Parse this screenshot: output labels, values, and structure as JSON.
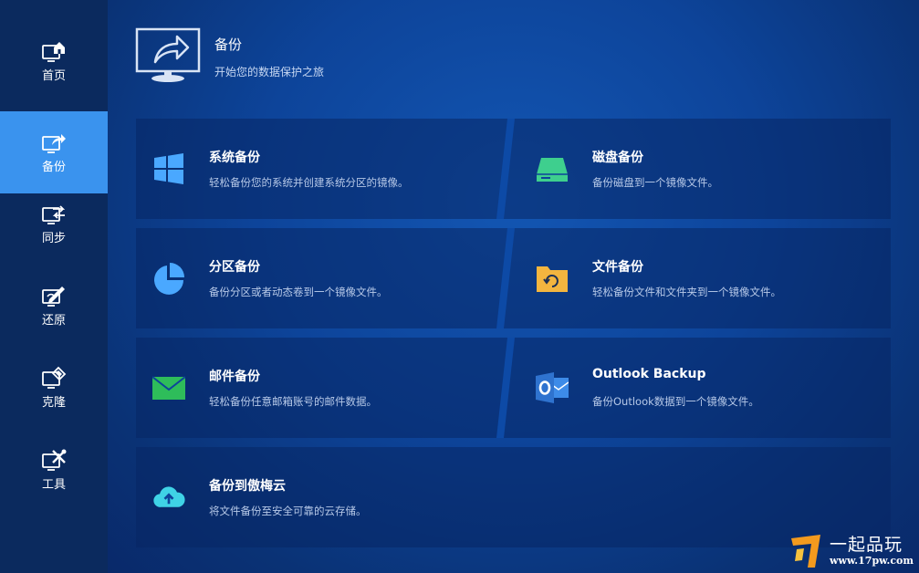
{
  "sidebar": {
    "items": [
      {
        "label": "首页",
        "icon": "home-monitor-icon",
        "active": false
      },
      {
        "label": "备份",
        "icon": "backup-monitor-icon",
        "active": true
      },
      {
        "label": "同步",
        "icon": "sync-icon",
        "active": false
      },
      {
        "label": "还原",
        "icon": "restore-monitor-icon",
        "active": false
      },
      {
        "label": "克隆",
        "icon": "clone-monitor-icon",
        "active": false
      },
      {
        "label": "工具",
        "icon": "tools-monitor-icon",
        "active": false
      }
    ]
  },
  "header": {
    "title": "备份",
    "subtitle": "开始您的数据保护之旅",
    "icon": "monitor-share-arrow-icon"
  },
  "tiles": [
    {
      "title": "系统备份",
      "desc": "轻松备份您的系统并创建系统分区的镜像。",
      "icon": "windows-logo-icon",
      "color": "#4aa8ff"
    },
    {
      "title": "磁盘备份",
      "desc": "备份磁盘到一个镜像文件。",
      "icon": "disk-drive-icon",
      "color": "#3ecf8e"
    },
    {
      "title": "分区备份",
      "desc": "备份分区或者动态卷到一个镜像文件。",
      "icon": "pie-chart-icon",
      "color": "#4aa8ff"
    },
    {
      "title": "文件备份",
      "desc": "轻松备份文件和文件夹到一个镜像文件。",
      "icon": "folder-refresh-icon",
      "color": "#f3b53f"
    },
    {
      "title": "邮件备份",
      "desc": "轻松备份任意邮箱账号的邮件数据。",
      "icon": "mail-envelope-icon",
      "color": "#2ebd5a"
    },
    {
      "title": "Outlook Backup",
      "desc": "备份Outlook数据到一个镜像文件。",
      "icon": "outlook-icon",
      "color": "#3d8be8"
    },
    {
      "title": "备份到傲梅云",
      "desc": "将文件备份至安全可靠的云存储。",
      "icon": "cloud-upload-icon",
      "color": "#3fd3e6"
    }
  ],
  "watermark": {
    "text": "一起品玩",
    "url": "www.17pw.com"
  },
  "colors": {
    "sidebar_bg": "#0b2a5e",
    "active_item": "#3a93ee",
    "main_bg": "#0d449a"
  }
}
